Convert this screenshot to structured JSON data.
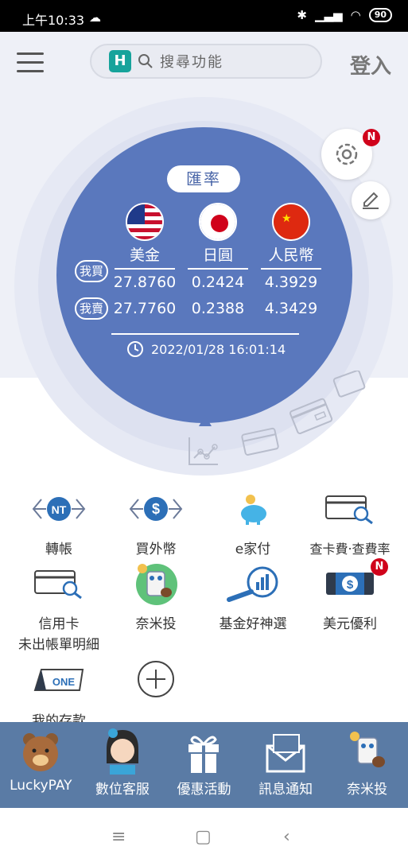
{
  "status_bar": {
    "time": "上午10:33",
    "battery": "90"
  },
  "header": {
    "search_placeholder": "搜尋功能",
    "login_label": "登入",
    "logo_char": "H"
  },
  "rate_card": {
    "title": "匯率",
    "buy_label": "我買",
    "sell_label": "我賣",
    "currencies": [
      {
        "name": "美金",
        "buy": "27.8760",
        "sell": "27.7760"
      },
      {
        "name": "日圓",
        "buy": "0.2424",
        "sell": "0.2388"
      },
      {
        "name": "人民幣",
        "buy": "4.3929",
        "sell": "4.3429"
      }
    ],
    "updated_at": "2022/01/28 16:01:14",
    "badge": "N"
  },
  "functions": [
    {
      "label": "轉帳",
      "icon": "nt-transfer-icon"
    },
    {
      "label": "買外幣",
      "icon": "currency-exchange-icon"
    },
    {
      "label": "e家付",
      "icon": "piggy-bank-icon"
    },
    {
      "label": "查卡費‧查費率",
      "icon": "card-search-icon"
    },
    {
      "label_line1": "信用卡",
      "label_line2": "未出帳單明細",
      "icon": "credit-card-search-icon"
    },
    {
      "label": "奈米投",
      "icon": "robot-invest-icon"
    },
    {
      "label": "基金好神選",
      "icon": "fund-chart-icon"
    },
    {
      "label": "美元優利",
      "icon": "dollar-bill-icon",
      "badge": "N"
    },
    {
      "label": "我的存款",
      "icon": "deposit-one-icon",
      "icon_text": "ONE"
    },
    {
      "label": "",
      "icon": "add-icon"
    }
  ],
  "bottom_nav": [
    {
      "label": "LuckyPAY",
      "icon": "bear-icon"
    },
    {
      "label": "數位客服",
      "icon": "agent-icon"
    },
    {
      "label": "優惠活動",
      "icon": "gift-icon"
    },
    {
      "label": "訊息通知",
      "icon": "mail-icon"
    },
    {
      "label": "奈米投",
      "icon": "robot-icon"
    }
  ],
  "colors": {
    "accent_blue": "#5a78bd",
    "nav_bar": "#5a7ba5",
    "badge_red": "#d0021b",
    "teal": "#16a39b"
  }
}
